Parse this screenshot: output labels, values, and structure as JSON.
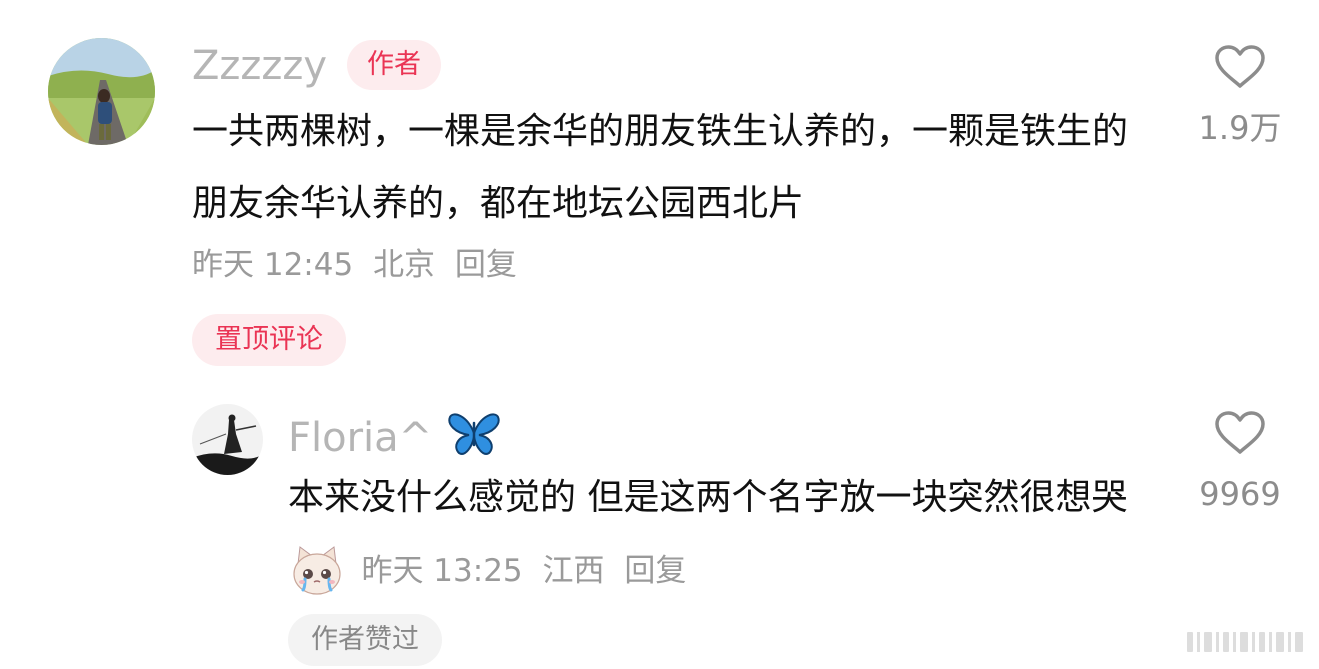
{
  "comments": [
    {
      "username": "Zzzzzy",
      "author_badge": "作者",
      "text": "一共两棵树，一棵是余华的朋友铁生认养的，一颗是铁生的朋友余华认养的，都在地坛公园西北片",
      "time": "昨天 12:45",
      "location": "北京",
      "reply_label": "回复",
      "like_count": "1.9万",
      "pinned_label": "置顶评论"
    },
    {
      "username": "Floria^",
      "username_emoji": "butterfly",
      "text_line": "本来没什么感觉的 但是这两个名字放一块突然很想哭",
      "text_emoji": "crying-cat-face",
      "time": "昨天 13:25",
      "location": "江西",
      "reply_label": "回复",
      "like_count": "9969",
      "liked_by_author_label": "作者赞过"
    }
  ],
  "icons": {
    "like": "heart-outline-icon",
    "watermark": "barcode-watermark"
  },
  "colors": {
    "accent": "#ea3454",
    "accent_bg": "#fdecee",
    "username": "#b5b5b5",
    "meta": "#9a9a9a",
    "text": "#111111"
  }
}
